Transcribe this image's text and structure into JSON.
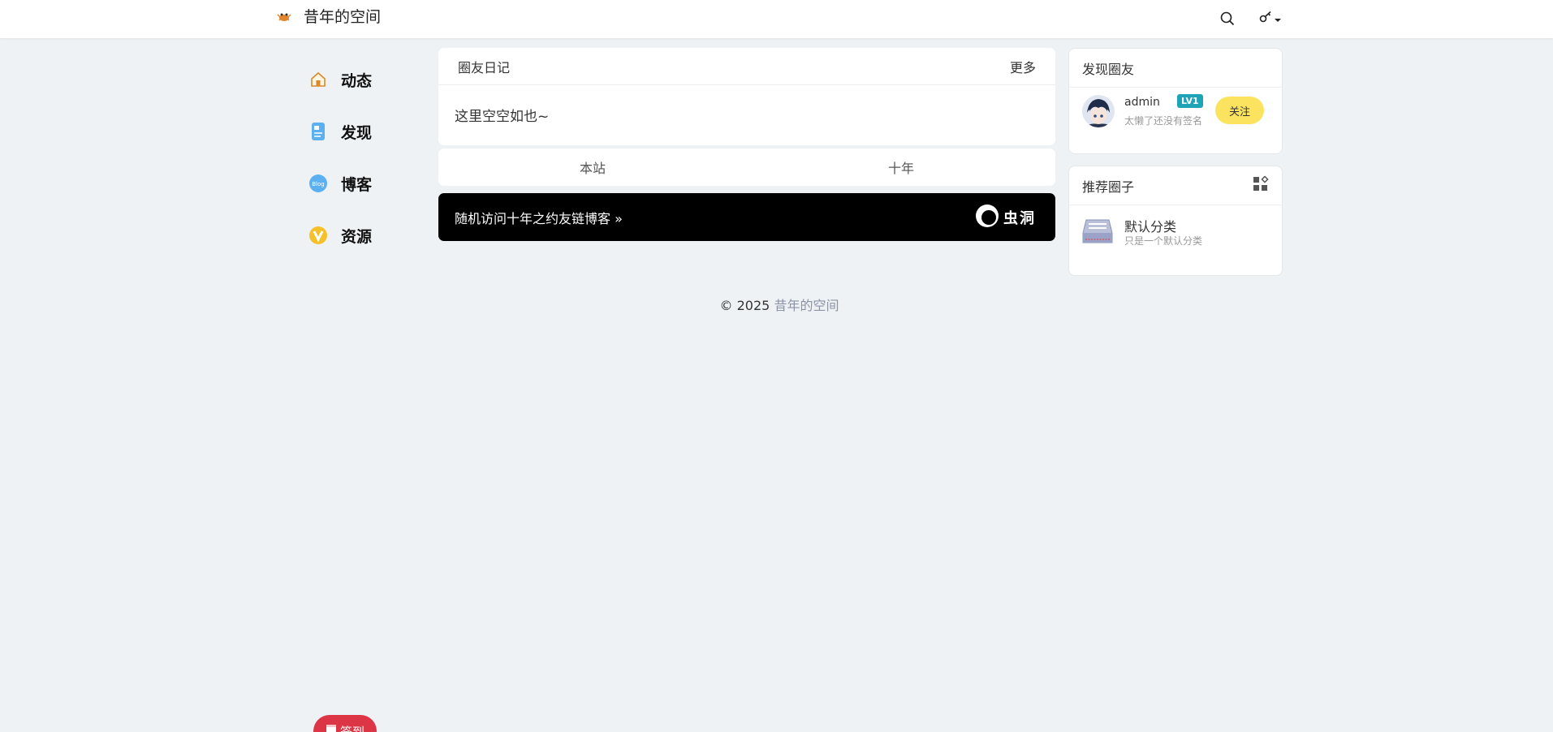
{
  "header": {
    "brand_title": "昔年的空间",
    "logo_icon": "crab-logo-icon",
    "search_icon": "search-icon",
    "user_menu_icon": "key-icon"
  },
  "left_nav": {
    "items": [
      {
        "label": "动态",
        "icon": "home-icon",
        "color": "#e8a13a"
      },
      {
        "label": "发现",
        "icon": "document-icon",
        "color": "#5ab0f0"
      },
      {
        "label": "博客",
        "icon": "blog-icon",
        "color": "#5ab0f0"
      },
      {
        "label": "资源",
        "icon": "v-coin-icon",
        "color": "#f5c02a"
      }
    ]
  },
  "diary": {
    "title": "圈友日记",
    "more_label": "更多",
    "empty_text": "这里空空如也~"
  },
  "tabs": [
    "本站",
    "十年"
  ],
  "wormhole": {
    "text": "随机访问十年之约友链博客 »",
    "logo_text": "虫洞"
  },
  "footer": {
    "copyright": "© 2025",
    "site_link": "昔年的空间"
  },
  "discover_friends": {
    "title": "发现圈友",
    "friend": {
      "name": "admin",
      "level": "LV1",
      "signature": "太懒了还没有签名",
      "follow_label": "关注"
    }
  },
  "recommended_circles": {
    "title": "推荐圈子",
    "header_icon": "grid-icon",
    "circle": {
      "name": "默认分类",
      "description": "只是一个默认分类"
    }
  },
  "sign_button": {
    "label": "签到"
  },
  "colors": {
    "background": "#eff2f5",
    "accent_yellow": "#fbe360",
    "level_badge": "#1fa3b6",
    "sign_red": "#dc3545"
  }
}
